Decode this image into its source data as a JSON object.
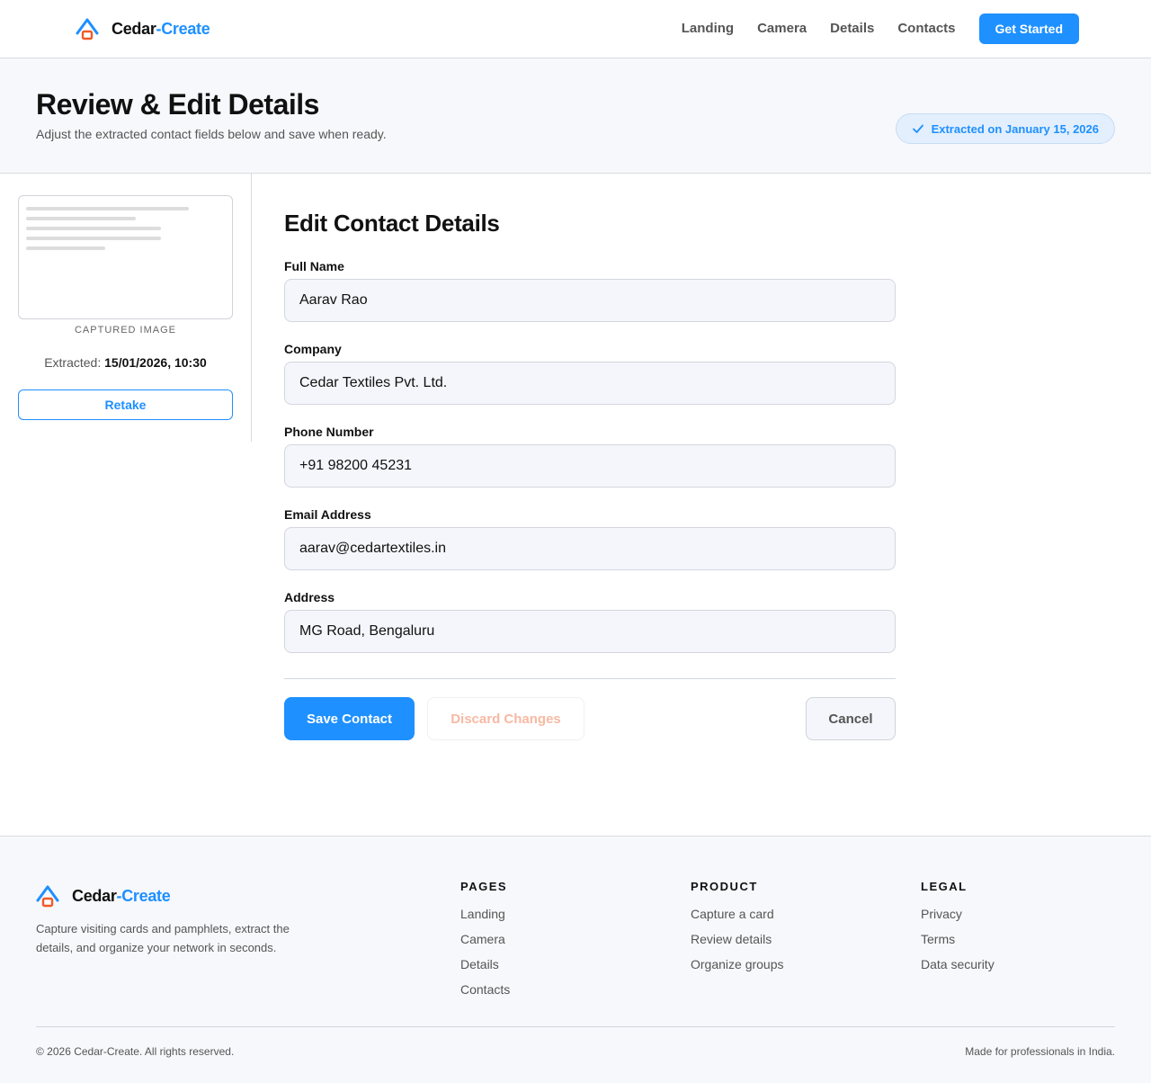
{
  "brand": {
    "name_part1": "Cedar",
    "name_part2": "-Create"
  },
  "nav": {
    "items": [
      "Landing",
      "Camera",
      "Details",
      "Contacts"
    ],
    "cta": "Get Started"
  },
  "hero": {
    "title": "Review & Edit Details",
    "subtitle": "Adjust the extracted contact fields below and save when ready.",
    "badge": "Extracted on January 15, 2026"
  },
  "sidebar": {
    "caption": "CAPTURED IMAGE",
    "extracted_label": "Extracted:",
    "extracted_value": "15/01/2026, 10:30",
    "retake": "Retake"
  },
  "form": {
    "title": "Edit Contact Details",
    "fields": [
      {
        "label": "Full Name",
        "value": "Aarav Rao"
      },
      {
        "label": "Company",
        "value": "Cedar Textiles Pvt. Ltd."
      },
      {
        "label": "Phone Number",
        "value": "+91 98200 45231"
      },
      {
        "label": "Email Address",
        "value": "aarav@cedartextiles.in"
      },
      {
        "label": "Address",
        "value": "MG Road, Bengaluru"
      }
    ],
    "save": "Save Contact",
    "discard": "Discard Changes",
    "cancel": "Cancel"
  },
  "footer": {
    "description": "Capture visiting cards and pamphlets, extract the details, and organize your network in seconds.",
    "pages": {
      "heading": "PAGES",
      "links": [
        "Landing",
        "Camera",
        "Details",
        "Contacts"
      ]
    },
    "product": {
      "heading": "PRODUCT",
      "links": [
        "Capture a card",
        "Review details",
        "Organize groups"
      ]
    },
    "legal": {
      "heading": "LEGAL",
      "links": [
        "Privacy",
        "Terms",
        "Data security"
      ]
    },
    "copyright": "© 2026 Cedar-Create. All rights reserved.",
    "made": "Made for professionals in India."
  },
  "colors": {
    "accent": "#1e90ff",
    "logo_secondary": "#f05a28",
    "discard_text": "#f7b9a3"
  },
  "icons": {
    "logo": "cedar-logo-icon",
    "badge": "check-icon"
  }
}
